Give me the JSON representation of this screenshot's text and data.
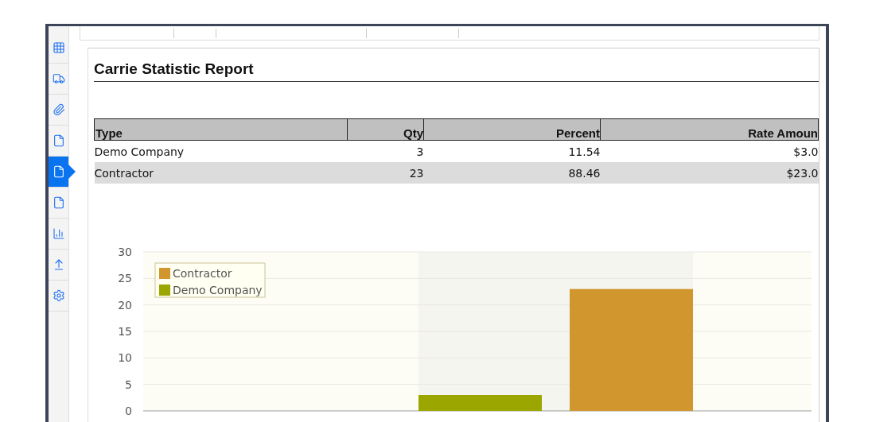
{
  "sidebar": {
    "items": [
      {
        "selected": false
      },
      {
        "selected": false
      },
      {
        "selected": false
      },
      {
        "selected": false
      },
      {
        "selected": true
      },
      {
        "selected": false
      },
      {
        "selected": false
      },
      {
        "selected": false
      },
      {
        "selected": false
      }
    ]
  },
  "report": {
    "title": "Carrie Statistic Report",
    "table": {
      "columns": [
        "Type",
        "Qty",
        "Percent",
        "Rate Amoun"
      ],
      "rows": [
        [
          "Demo Company",
          "3",
          "11.54",
          "$3.0"
        ],
        [
          "Contractor",
          "23",
          "88.46",
          "$23.0"
        ]
      ]
    },
    "chart_data": {
      "type": "bar",
      "grid": true,
      "legend": true,
      "ylim": [
        0,
        30
      ],
      "yticks": [
        0,
        5,
        10,
        15,
        20,
        25,
        30
      ],
      "series": [
        {
          "name": "Contractor",
          "color": "#d1962e",
          "values": [
            23
          ]
        },
        {
          "name": "Demo Company",
          "color": "#9ca600",
          "values": [
            3
          ]
        }
      ]
    }
  }
}
